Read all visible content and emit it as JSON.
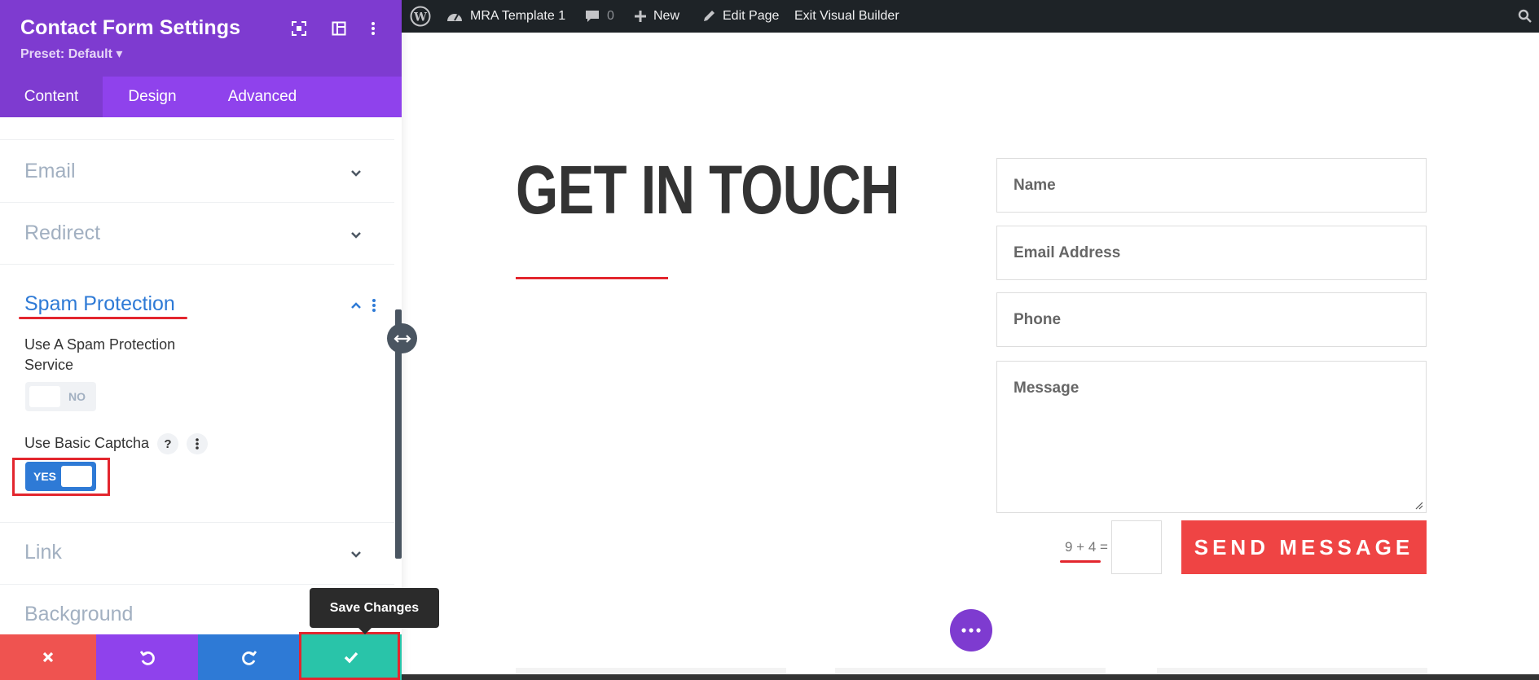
{
  "panel": {
    "title": "Contact Form Settings",
    "preset": "Preset: Default ▾",
    "tabs": [
      {
        "label": "Content",
        "active": true
      },
      {
        "label": "Design",
        "active": false
      },
      {
        "label": "Advanced",
        "active": false
      }
    ],
    "sections": {
      "email": "Email",
      "redirect": "Redirect",
      "spam": "Spam Protection",
      "link": "Link",
      "background": "Background"
    },
    "spam_options": {
      "service_label_line1": "Use A Spam Protection",
      "service_label_line2": "Service",
      "service_toggle": "NO",
      "captcha_label": "Use Basic Captcha",
      "captcha_help": "?",
      "captcha_toggle": "YES"
    },
    "tooltip": "Save Changes"
  },
  "adminbar": {
    "site_name": "MRA Template 1",
    "comments_count": "0",
    "new_label": "New",
    "edit_label": "Edit Page",
    "exit_label": "Exit Visual Builder"
  },
  "page": {
    "headline": "GET IN TOUCH",
    "fields": {
      "name": "Name",
      "email": "Email Address",
      "phone": "Phone",
      "message": "Message"
    },
    "captcha": "9 + 4 =",
    "send_label": "SEND MESSAGE"
  },
  "colors": {
    "purple": "#7e3bd0",
    "purple_tab": "#8f42ec",
    "blue": "#2e7ad6",
    "red": "#ef4444",
    "green": "#29c4a9"
  }
}
